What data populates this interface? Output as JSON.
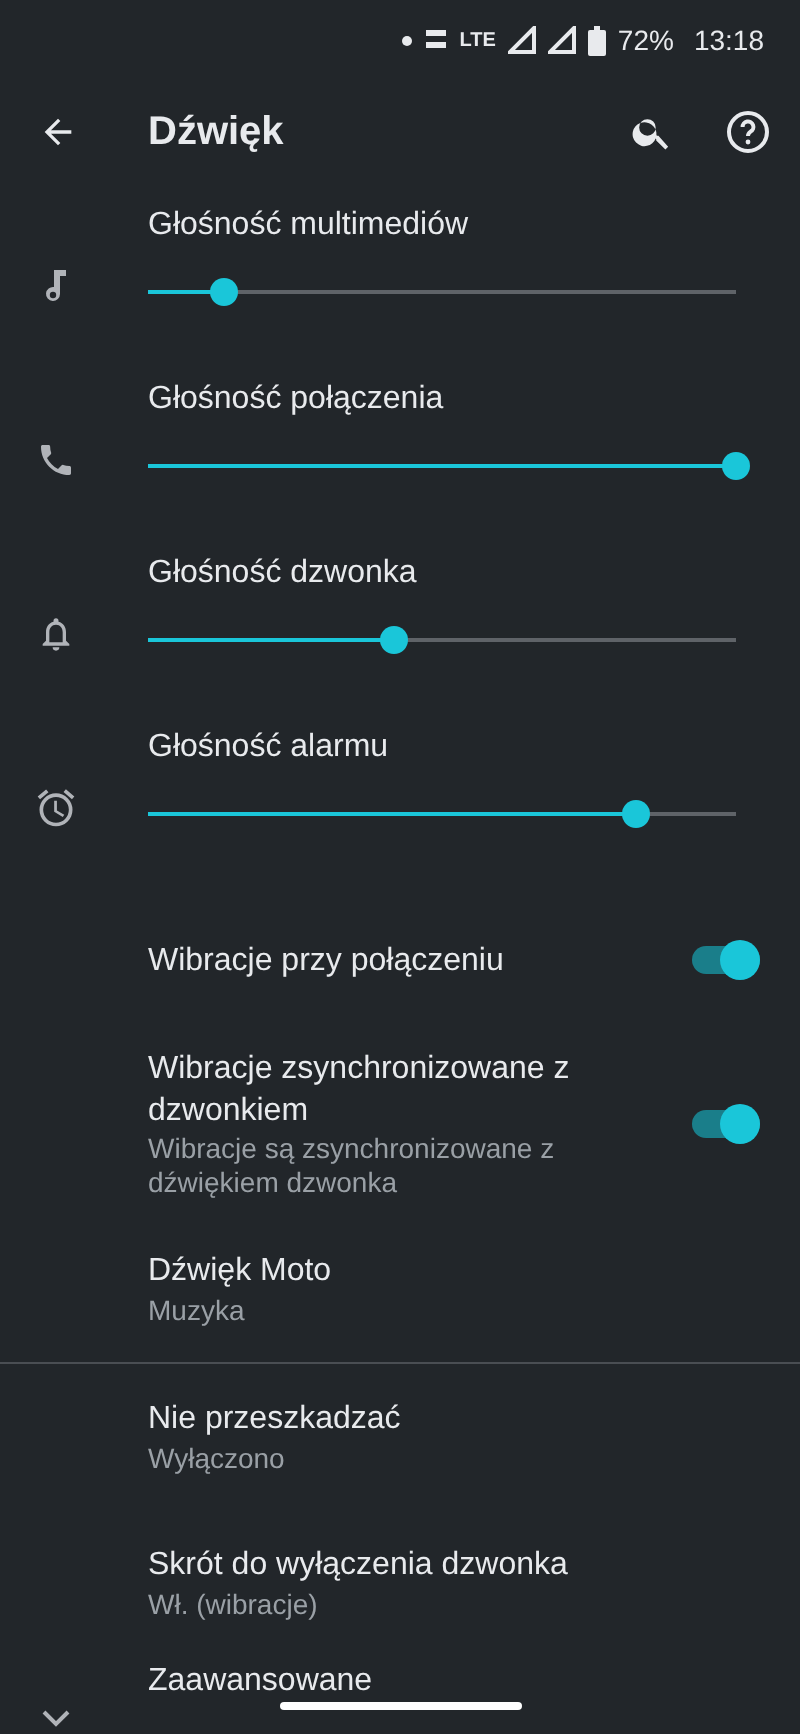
{
  "status_bar": {
    "network": "LTE",
    "battery": "72%",
    "time": "13:18"
  },
  "header": {
    "title": "Dźwięk"
  },
  "sliders": [
    {
      "kind": "music",
      "label": "Głośność multimediów",
      "level": 0.13
    },
    {
      "kind": "phone",
      "label": "Głośność połączenia",
      "level": 1.0
    },
    {
      "kind": "bell",
      "label": "Głośność dzwonka",
      "level": 0.42
    },
    {
      "kind": "alarm",
      "label": "Głośność alarmu",
      "level": 0.83
    }
  ],
  "settings": [
    {
      "kind": "toggle",
      "title": "Wibracje przy połączeniu",
      "on": true
    },
    {
      "kind": "toggle",
      "title": "Wibracje zsynchronizowane z dzwonkiem",
      "summary": "Wibracje są zsynchronizowane z dźwiękiem dzwonka",
      "on": true
    },
    {
      "kind": "item",
      "title": "Dźwięk Moto",
      "summary": "Muzyka"
    },
    {
      "kind": "divider"
    },
    {
      "kind": "item",
      "title": "Nie przeszkadzać",
      "summary": "Wyłączono"
    },
    {
      "kind": "item",
      "title": "Skrót do wyłączenia dzwonka",
      "summary": "Wł. (wibracje)"
    },
    {
      "kind": "expander",
      "title": "Zaawansowane"
    }
  ]
}
